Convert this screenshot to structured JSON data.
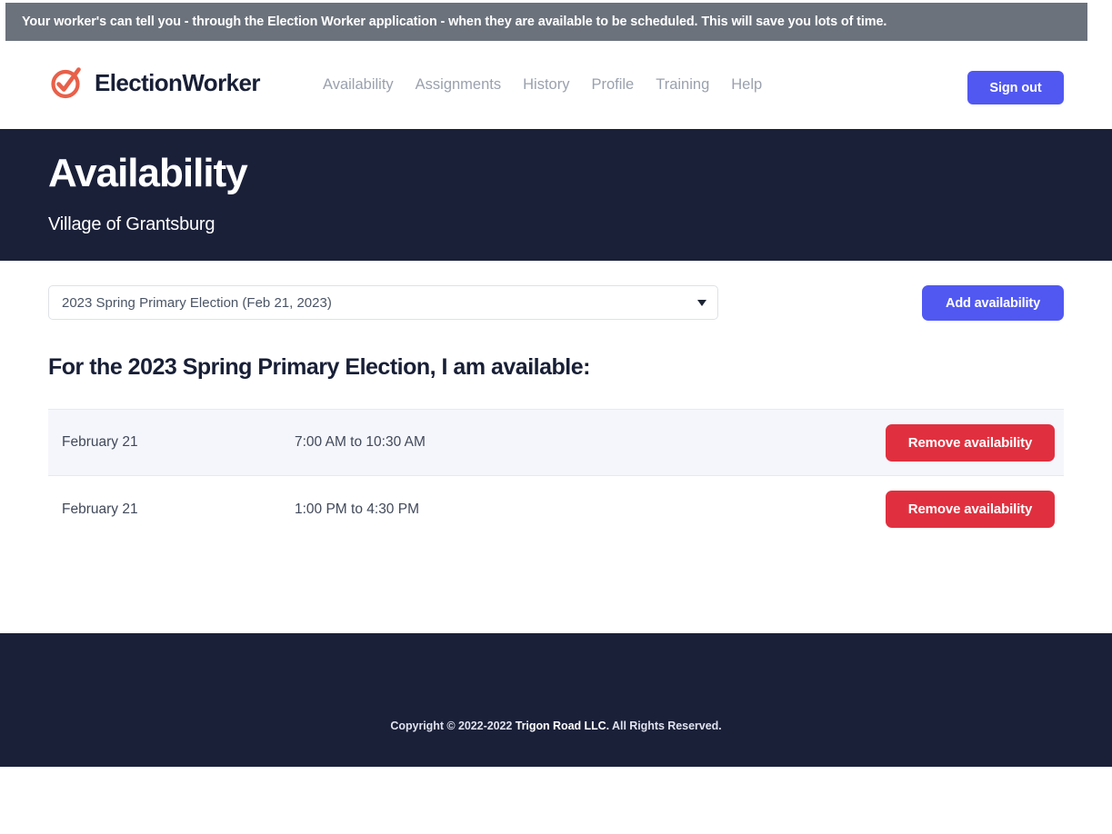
{
  "notice": {
    "text": "Your worker's can tell you - through the Election Worker application - when they are available to be scheduled. This will save you lots of time.",
    "background_color": "#6b727c"
  },
  "header": {
    "brand_name": "ElectionWorker",
    "brand_icon": "circle-check-icon",
    "brand_color": "#e8604a",
    "nav_items": [
      {
        "label": "Availability"
      },
      {
        "label": "Assignments"
      },
      {
        "label": "History"
      },
      {
        "label": "Profile"
      },
      {
        "label": "Training"
      },
      {
        "label": "Help"
      }
    ],
    "signout_label": "Sign out",
    "accent_color": "#5158f2"
  },
  "hero": {
    "title": "Availability",
    "subtitle": "Village of Grantsburg",
    "background_color": "#1b2039"
  },
  "main": {
    "election_select": {
      "selected": "2023 Spring Primary Election (Feb 21, 2023)",
      "caret_icon": "chevron-down-icon"
    },
    "add_availability_label": "Add availability",
    "heading": "For the 2023 Spring Primary Election, I am available:",
    "rows": [
      {
        "date": "February 21",
        "time": "7:00 AM to 10:30 AM",
        "remove_label": "Remove availability"
      },
      {
        "date": "February 21",
        "time": "1:00 PM to 4:30 PM",
        "remove_label": "Remove availability"
      }
    ],
    "danger_color": "#e0303f"
  },
  "footer": {
    "copyright_prefix": "Copyright © 2022-2022 ",
    "company": "Trigon Road LLC",
    "copyright_suffix": ". All Rights Reserved.",
    "background_color": "#1b2039"
  }
}
